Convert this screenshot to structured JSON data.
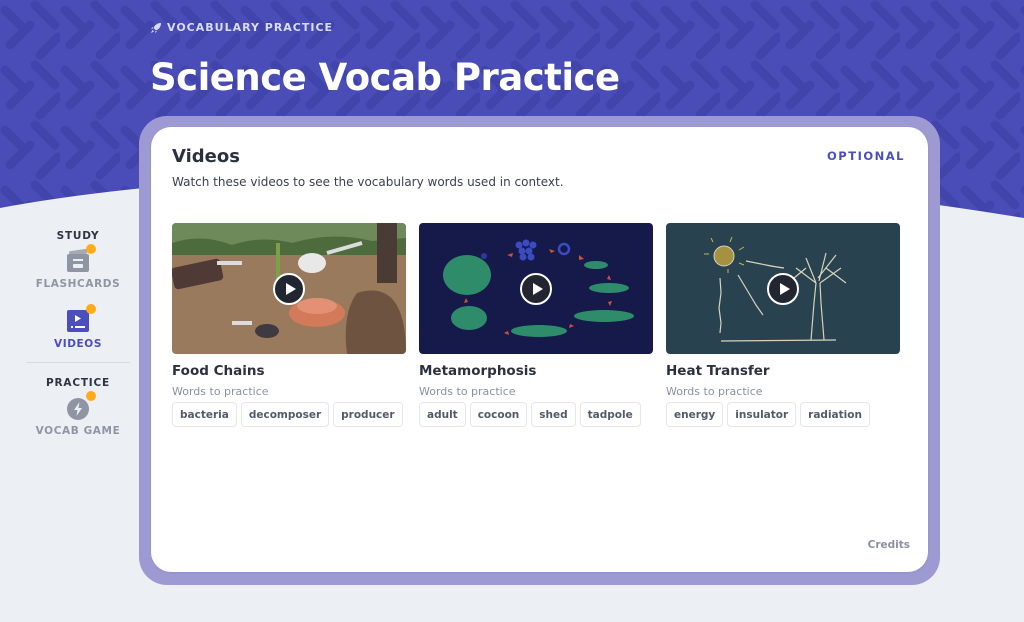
{
  "header": {
    "eyebrow_icon": "rocket-icon",
    "eyebrow": "VOCABULARY PRACTICE",
    "title": "Science Vocab Practice"
  },
  "sidebar": {
    "sections": [
      {
        "heading": "STUDY",
        "items": [
          {
            "label": "FLASHCARDS",
            "icon": "flashcards-icon",
            "active": false,
            "notification": true
          },
          {
            "label": "VIDEOS",
            "icon": "video-icon",
            "active": true,
            "notification": true
          }
        ]
      },
      {
        "heading": "PRACTICE",
        "items": [
          {
            "label": "VOCAB GAME",
            "icon": "lightning-icon",
            "active": false,
            "notification": true
          }
        ]
      }
    ]
  },
  "card": {
    "title": "Videos",
    "subtitle": "Watch these videos to see the vocabulary words used in context.",
    "badge": "OPTIONAL",
    "credits": "Credits",
    "videos": [
      {
        "title": "Food Chains",
        "words_label": "Words to practice",
        "thumbnail": "food-chain-illustration",
        "words": [
          "bacteria",
          "decomposer",
          "producer"
        ]
      },
      {
        "title": "Metamorphosis",
        "words_label": "Words to practice",
        "thumbnail": "frog-lifecycle-illustration",
        "words": [
          "adult",
          "cocoon",
          "shed",
          "tadpole"
        ]
      },
      {
        "title": "Heat Transfer",
        "words_label": "Words to practice",
        "thumbnail": "sun-tree-chalk-illustration",
        "words": [
          "energy",
          "insulator",
          "radiation"
        ]
      }
    ]
  },
  "colors": {
    "brand": "#4b4ebc",
    "hero": "#4a4cb8",
    "frame": "#9d9ad3",
    "notification": "#ffab1a"
  }
}
